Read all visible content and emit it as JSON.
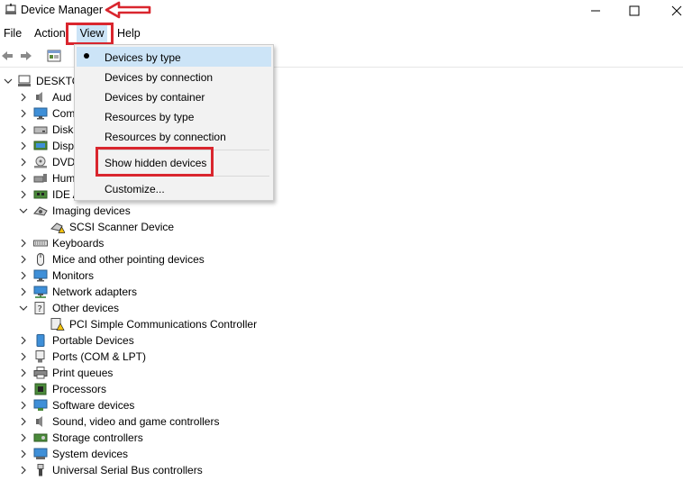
{
  "window": {
    "title": "Device Manager"
  },
  "menubar": {
    "file": "File",
    "action": "Action",
    "view": "View",
    "help": "Help"
  },
  "view_menu": {
    "items": [
      {
        "label": "Devices by type",
        "selected": true
      },
      {
        "label": "Devices by connection"
      },
      {
        "label": "Devices by container"
      },
      {
        "label": "Resources by type"
      },
      {
        "label": "Resources by connection"
      },
      {
        "label": "Show hidden devices"
      },
      {
        "label": "Customize..."
      }
    ]
  },
  "tree": {
    "root": "DESKTO",
    "partial": [
      "Aud",
      "Com",
      "Disk",
      "Disp",
      "DVD",
      "Hum",
      "IDE A"
    ],
    "imaging": "Imaging devices",
    "scsi": "SCSI Scanner Device",
    "keyboards": "Keyboards",
    "mice": "Mice and other pointing devices",
    "monitors": "Monitors",
    "network": "Network adapters",
    "other": "Other devices",
    "pci": "PCI Simple Communications Controller",
    "portable": "Portable Devices",
    "ports": "Ports (COM & LPT)",
    "print": "Print queues",
    "processors": "Processors",
    "software": "Software devices",
    "sound": "Sound, video and game controllers",
    "storage": "Storage controllers",
    "system": "System devices",
    "usb": "Universal Serial Bus controllers"
  },
  "colors": {
    "highlight_box": "#d9262e",
    "menu_hover": "#cce4f7"
  }
}
